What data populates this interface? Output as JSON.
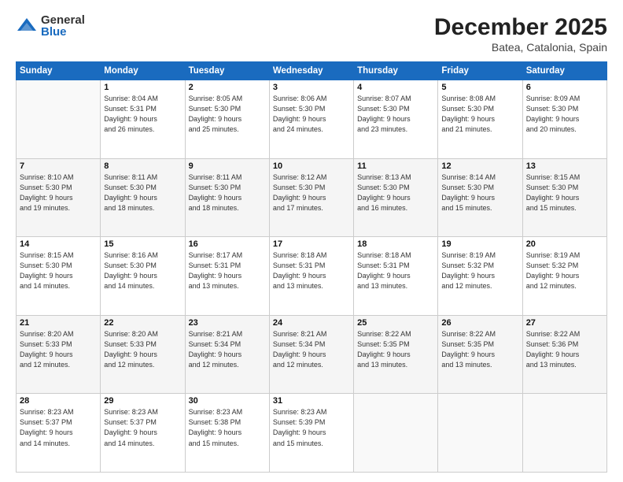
{
  "logo": {
    "general": "General",
    "blue": "Blue"
  },
  "header": {
    "month": "December 2025",
    "location": "Batea, Catalonia, Spain"
  },
  "weekdays": [
    "Sunday",
    "Monday",
    "Tuesday",
    "Wednesday",
    "Thursday",
    "Friday",
    "Saturday"
  ],
  "weeks": [
    [
      {
        "day": "",
        "info": ""
      },
      {
        "day": "1",
        "info": "Sunrise: 8:04 AM\nSunset: 5:31 PM\nDaylight: 9 hours\nand 26 minutes."
      },
      {
        "day": "2",
        "info": "Sunrise: 8:05 AM\nSunset: 5:30 PM\nDaylight: 9 hours\nand 25 minutes."
      },
      {
        "day": "3",
        "info": "Sunrise: 8:06 AM\nSunset: 5:30 PM\nDaylight: 9 hours\nand 24 minutes."
      },
      {
        "day": "4",
        "info": "Sunrise: 8:07 AM\nSunset: 5:30 PM\nDaylight: 9 hours\nand 23 minutes."
      },
      {
        "day": "5",
        "info": "Sunrise: 8:08 AM\nSunset: 5:30 PM\nDaylight: 9 hours\nand 21 minutes."
      },
      {
        "day": "6",
        "info": "Sunrise: 8:09 AM\nSunset: 5:30 PM\nDaylight: 9 hours\nand 20 minutes."
      }
    ],
    [
      {
        "day": "7",
        "info": "Sunrise: 8:10 AM\nSunset: 5:30 PM\nDaylight: 9 hours\nand 19 minutes."
      },
      {
        "day": "8",
        "info": "Sunrise: 8:11 AM\nSunset: 5:30 PM\nDaylight: 9 hours\nand 18 minutes."
      },
      {
        "day": "9",
        "info": "Sunrise: 8:11 AM\nSunset: 5:30 PM\nDaylight: 9 hours\nand 18 minutes."
      },
      {
        "day": "10",
        "info": "Sunrise: 8:12 AM\nSunset: 5:30 PM\nDaylight: 9 hours\nand 17 minutes."
      },
      {
        "day": "11",
        "info": "Sunrise: 8:13 AM\nSunset: 5:30 PM\nDaylight: 9 hours\nand 16 minutes."
      },
      {
        "day": "12",
        "info": "Sunrise: 8:14 AM\nSunset: 5:30 PM\nDaylight: 9 hours\nand 15 minutes."
      },
      {
        "day": "13",
        "info": "Sunrise: 8:15 AM\nSunset: 5:30 PM\nDaylight: 9 hours\nand 15 minutes."
      }
    ],
    [
      {
        "day": "14",
        "info": "Sunrise: 8:15 AM\nSunset: 5:30 PM\nDaylight: 9 hours\nand 14 minutes."
      },
      {
        "day": "15",
        "info": "Sunrise: 8:16 AM\nSunset: 5:30 PM\nDaylight: 9 hours\nand 14 minutes."
      },
      {
        "day": "16",
        "info": "Sunrise: 8:17 AM\nSunset: 5:31 PM\nDaylight: 9 hours\nand 13 minutes."
      },
      {
        "day": "17",
        "info": "Sunrise: 8:18 AM\nSunset: 5:31 PM\nDaylight: 9 hours\nand 13 minutes."
      },
      {
        "day": "18",
        "info": "Sunrise: 8:18 AM\nSunset: 5:31 PM\nDaylight: 9 hours\nand 13 minutes."
      },
      {
        "day": "19",
        "info": "Sunrise: 8:19 AM\nSunset: 5:32 PM\nDaylight: 9 hours\nand 12 minutes."
      },
      {
        "day": "20",
        "info": "Sunrise: 8:19 AM\nSunset: 5:32 PM\nDaylight: 9 hours\nand 12 minutes."
      }
    ],
    [
      {
        "day": "21",
        "info": "Sunrise: 8:20 AM\nSunset: 5:33 PM\nDaylight: 9 hours\nand 12 minutes."
      },
      {
        "day": "22",
        "info": "Sunrise: 8:20 AM\nSunset: 5:33 PM\nDaylight: 9 hours\nand 12 minutes."
      },
      {
        "day": "23",
        "info": "Sunrise: 8:21 AM\nSunset: 5:34 PM\nDaylight: 9 hours\nand 12 minutes."
      },
      {
        "day": "24",
        "info": "Sunrise: 8:21 AM\nSunset: 5:34 PM\nDaylight: 9 hours\nand 12 minutes."
      },
      {
        "day": "25",
        "info": "Sunrise: 8:22 AM\nSunset: 5:35 PM\nDaylight: 9 hours\nand 13 minutes."
      },
      {
        "day": "26",
        "info": "Sunrise: 8:22 AM\nSunset: 5:35 PM\nDaylight: 9 hours\nand 13 minutes."
      },
      {
        "day": "27",
        "info": "Sunrise: 8:22 AM\nSunset: 5:36 PM\nDaylight: 9 hours\nand 13 minutes."
      }
    ],
    [
      {
        "day": "28",
        "info": "Sunrise: 8:23 AM\nSunset: 5:37 PM\nDaylight: 9 hours\nand 14 minutes."
      },
      {
        "day": "29",
        "info": "Sunrise: 8:23 AM\nSunset: 5:37 PM\nDaylight: 9 hours\nand 14 minutes."
      },
      {
        "day": "30",
        "info": "Sunrise: 8:23 AM\nSunset: 5:38 PM\nDaylight: 9 hours\nand 15 minutes."
      },
      {
        "day": "31",
        "info": "Sunrise: 8:23 AM\nSunset: 5:39 PM\nDaylight: 9 hours\nand 15 minutes."
      },
      {
        "day": "",
        "info": ""
      },
      {
        "day": "",
        "info": ""
      },
      {
        "day": "",
        "info": ""
      }
    ]
  ]
}
